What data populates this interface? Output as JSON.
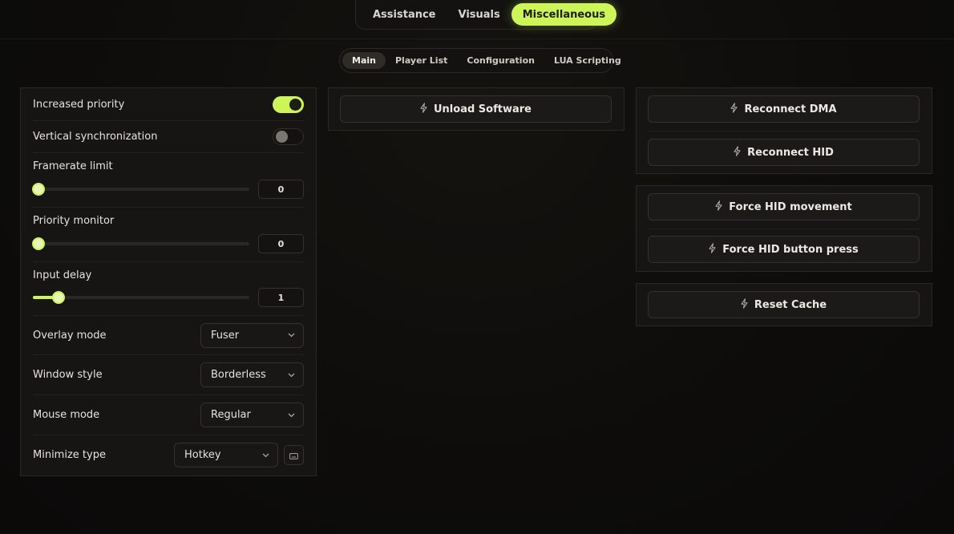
{
  "top_tabs": [
    {
      "label": "Assistance",
      "active": false
    },
    {
      "label": "Visuals",
      "active": false
    },
    {
      "label": "Miscellaneous",
      "active": true
    }
  ],
  "sub_tabs": [
    {
      "label": "Main",
      "active": true
    },
    {
      "label": "Player List",
      "active": false
    },
    {
      "label": "Configuration",
      "active": false
    },
    {
      "label": "LUA Scripting",
      "active": false
    }
  ],
  "settings": {
    "increased_priority": {
      "label": "Increased priority",
      "enabled": true
    },
    "vertical_sync": {
      "label": "Vertical synchronization",
      "enabled": false
    },
    "framerate_limit": {
      "label": "Framerate limit",
      "value": "0",
      "fraction": 0.0
    },
    "priority_monitor": {
      "label": "Priority monitor",
      "value": "0",
      "fraction": 0.0
    },
    "input_delay": {
      "label": "Input delay",
      "value": "1",
      "fraction": 0.12
    },
    "overlay_mode": {
      "label": "Overlay mode",
      "selected": "Fuser"
    },
    "window_style": {
      "label": "Window style",
      "selected": "Borderless"
    },
    "mouse_mode": {
      "label": "Mouse mode",
      "selected": "Regular"
    },
    "minimize_type": {
      "label": "Minimize type",
      "selected": "Hotkey"
    }
  },
  "actions": {
    "unload_software": "Unload Software",
    "reconnect_dma": "Reconnect DMA",
    "reconnect_hid": "Reconnect HID",
    "force_hid_movement": "Force HID movement",
    "force_hid_button_press": "Force HID button press",
    "reset_cache": "Reset Cache"
  },
  "colors": {
    "accent": "#cdf55a",
    "background": "#0e0d0c",
    "panel": "#161513"
  },
  "icons": {
    "action": "lightning-icon",
    "dropdown": "chevron-down-icon",
    "hotkey": "keyboard-icon"
  }
}
